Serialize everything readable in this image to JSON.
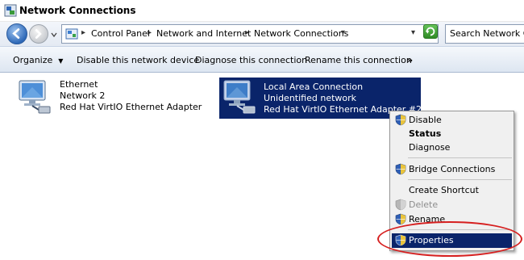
{
  "window": {
    "title": "Network Connections"
  },
  "address": {
    "breadcrumb": [
      "Control Panel",
      "Network and Internet",
      "Network Connections"
    ],
    "search_placeholder": "Search Network Co"
  },
  "toolbar": {
    "organize": "Organize",
    "disable": "Disable this network device",
    "diagnose": "Diagnose this connection",
    "rename": "Rename this connection",
    "more": "»"
  },
  "connections": [
    {
      "name": "Ethernet",
      "network": "Network  2",
      "adapter": "Red Hat VirtIO Ethernet Adapter",
      "selected": false
    },
    {
      "name": "Local Area Connection",
      "network": "Unidentified network",
      "adapter": "Red Hat VirtIO Ethernet Adapter #2",
      "selected": true
    }
  ],
  "context_menu": {
    "items": [
      {
        "label": "Disable",
        "icon": "shield-icon",
        "style": "normal"
      },
      {
        "label": "Status",
        "icon": "",
        "style": "bold"
      },
      {
        "label": "Diagnose",
        "icon": "",
        "style": "normal"
      },
      {
        "label": "Bridge Connections",
        "icon": "shield-icon",
        "style": "normal"
      },
      {
        "label": "Create Shortcut",
        "icon": "",
        "style": "normal"
      },
      {
        "label": "Delete",
        "icon": "shield-icon",
        "style": "disabled"
      },
      {
        "label": "Rename",
        "icon": "shield-icon",
        "style": "normal"
      },
      {
        "label": "Properties",
        "icon": "shield-icon",
        "style": "highlighted"
      }
    ]
  },
  "annotation": {
    "color": "#d61f1f"
  },
  "colors": {
    "selection": "#0a246a",
    "menu_bg": "#f0f0f0"
  }
}
